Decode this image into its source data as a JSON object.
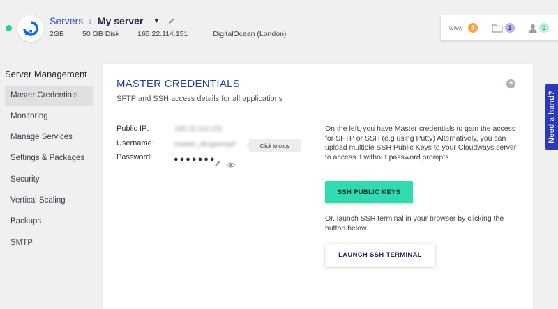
{
  "header": {
    "breadcrumb_root": "Servers",
    "breadcrumb_sep": "›",
    "server_name": "My server",
    "caret": "▼",
    "meta": {
      "ram": "2GB",
      "disk": "50 GB Disk",
      "ip": "165.22.114.151",
      "provider": "DigitalOcean (London)"
    },
    "counters": {
      "www_label": "www",
      "www_count": "4",
      "files_count": "1",
      "users_count": "0"
    }
  },
  "sidebar": {
    "title": "Server Management",
    "items": [
      {
        "label": "Master Credentials",
        "active": true
      },
      {
        "label": "Monitoring"
      },
      {
        "label": "Manage Services"
      },
      {
        "label": "Settings & Packages"
      },
      {
        "label": "Security"
      },
      {
        "label": "Vertical Scaling"
      },
      {
        "label": "Backups"
      },
      {
        "label": "SMTP"
      }
    ]
  },
  "panel": {
    "title": "MASTER CREDENTIALS",
    "subtitle": "SFTP and SSH access details for all applications",
    "help": "?",
    "credentials": {
      "public_ip_label": "Public IP:",
      "public_ip_value": "165.22.114.151",
      "username_label": "Username:",
      "username_value": "master_xkcgwxnqcf",
      "password_label": "Password:",
      "password_mask": "●●●●●●●",
      "tooltip": "Click to copy"
    },
    "info_text": "On the left, you have Master credentials to gain the access for SFTP or SSH (e.g using Putty) Alternatively, you can upload multiple SSH Public Keys to your Cloudways server to access it without password prompts.",
    "ssh_keys_button": "SSH PUBLIC KEYS",
    "info_text_2": "Or, launch SSH terminal in your browser by clicking the button below.",
    "terminal_button": "LAUNCH SSH TERMINAL"
  },
  "need_hand": "Need a hand?",
  "colors": {
    "accent": "#2a3ab8",
    "primary_button": "#2fdbb0",
    "status_online": "#27d38a"
  }
}
